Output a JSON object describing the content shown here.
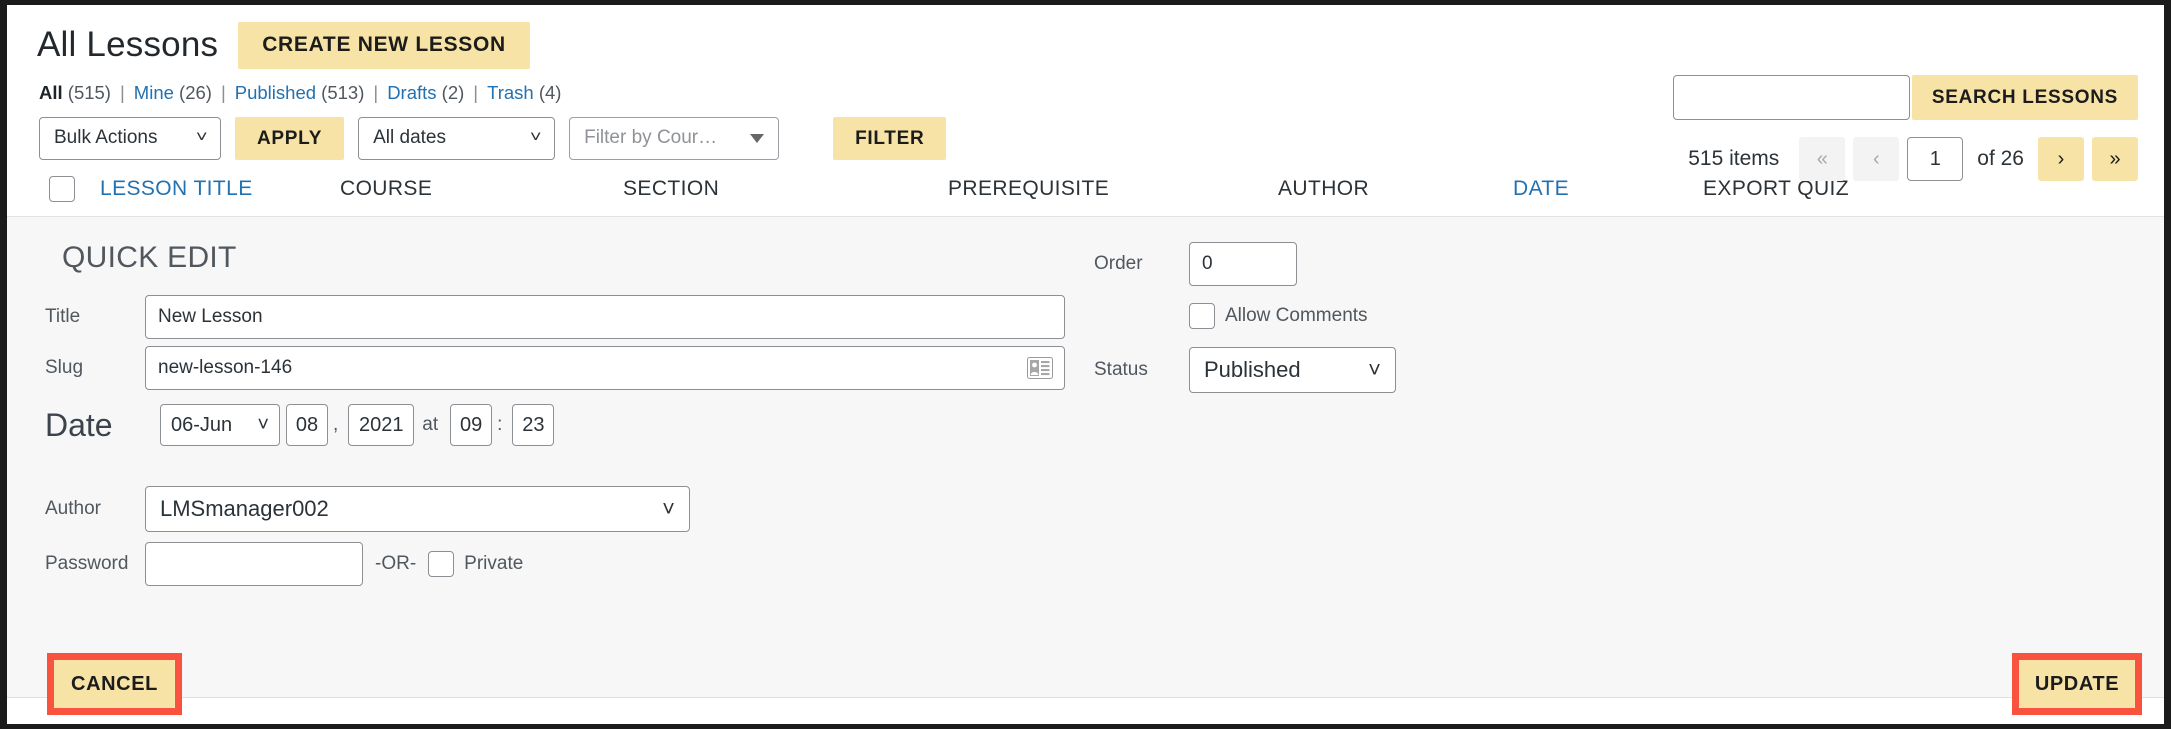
{
  "header": {
    "title": "All Lessons",
    "create_button": "CREATE NEW LESSON"
  },
  "status_links": [
    {
      "label": "All",
      "count": "(515)",
      "current": true
    },
    {
      "label": "Mine",
      "count": "(26)",
      "current": false
    },
    {
      "label": "Published",
      "count": "(513)",
      "current": false
    },
    {
      "label": "Drafts",
      "count": "(2)",
      "current": false
    },
    {
      "label": "Trash",
      "count": "(4)",
      "current": false
    }
  ],
  "separator": "|",
  "filters": {
    "bulk_actions": "Bulk Actions",
    "apply_button": "APPLY",
    "all_dates": "All dates",
    "course_filter_placeholder": "Filter by Cour…",
    "filter_button": "FILTER"
  },
  "search": {
    "value": "",
    "placeholder": "",
    "button": "SEARCH LESSONS"
  },
  "pagination": {
    "items_label": "515 items",
    "first": "«",
    "prev": "‹",
    "current_page": "1",
    "of_total": "of 26",
    "next": "›",
    "last": "»"
  },
  "table": {
    "columns": [
      {
        "label": "LESSON TITLE",
        "sortable": true
      },
      {
        "label": "COURSE",
        "sortable": false
      },
      {
        "label": "SECTION",
        "sortable": false
      },
      {
        "label": "PREREQUISITE",
        "sortable": false
      },
      {
        "label": "AUTHOR",
        "sortable": false
      },
      {
        "label": "DATE",
        "sortable": true
      },
      {
        "label": "EXPORT QUIZ",
        "sortable": false
      }
    ]
  },
  "quick_edit": {
    "heading": "QUICK EDIT",
    "title_label": "Title",
    "title_value": "New Lesson",
    "slug_label": "Slug",
    "slug_value": "new-lesson-146",
    "date_label": "Date",
    "date_month": "06-Jun",
    "date_day": "08",
    "date_comma": ",",
    "date_year": "2021",
    "date_at": "at",
    "date_hour": "09",
    "date_colon": ":",
    "date_minute": "23",
    "author_label": "Author",
    "author_value": "LMSmanager002",
    "password_label": "Password",
    "password_value": "",
    "or_text": "-OR-",
    "private_label": "Private",
    "order_label": "Order",
    "order_value": "0",
    "allow_comments_label": "Allow Comments",
    "status_label": "Status",
    "status_value": "Published",
    "cancel_button": "CANCEL",
    "update_button": "UPDATE"
  },
  "colors": {
    "accent_yellow": "#f7e3a5",
    "link_blue": "#2271b1",
    "highlight_red": "#f9533f",
    "panel_bg": "#f7f7f7"
  }
}
